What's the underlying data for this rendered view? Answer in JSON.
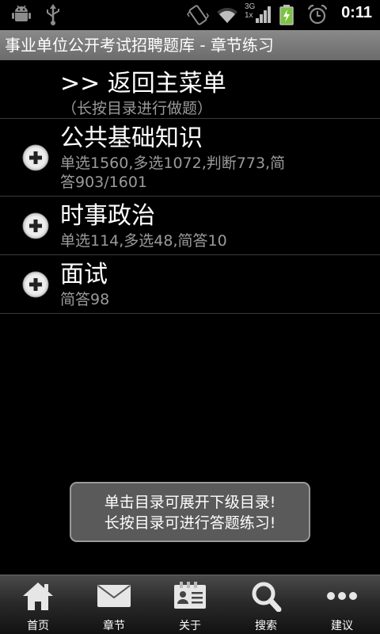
{
  "status_bar": {
    "time": "0:11",
    "network_label_top": "3G",
    "network_label_bottom": "1x",
    "icons": [
      "android-icon",
      "usb-icon",
      "vibrate-icon",
      "wifi-icon",
      "signal-icon",
      "battery-charging-icon",
      "alarm-icon"
    ]
  },
  "title_bar": {
    "title": "事业单位公开考试招聘题库 - 章节练习"
  },
  "list": {
    "back_item": {
      "label": ">> 返回主菜单",
      "hint": "（长按目录进行做题）"
    },
    "categories": [
      {
        "title": "公共基础知识",
        "detail": "单选1560,多选1072,判断773,简答903/1601"
      },
      {
        "title": "时事政治",
        "detail": "单选114,多选48,简答10"
      },
      {
        "title": "面试",
        "detail": "简答98"
      }
    ]
  },
  "toast": {
    "line1": "单击目录可展开下级目录!",
    "line2": "长按目录可进行答题练习!"
  },
  "tab_bar": {
    "tabs": [
      {
        "label": "首页",
        "icon": "home-icon"
      },
      {
        "label": "章节",
        "icon": "mail-icon"
      },
      {
        "label": "关于",
        "icon": "contact-card-icon"
      },
      {
        "label": "搜索",
        "icon": "search-icon"
      },
      {
        "label": "建议",
        "icon": "more-icon"
      }
    ]
  }
}
